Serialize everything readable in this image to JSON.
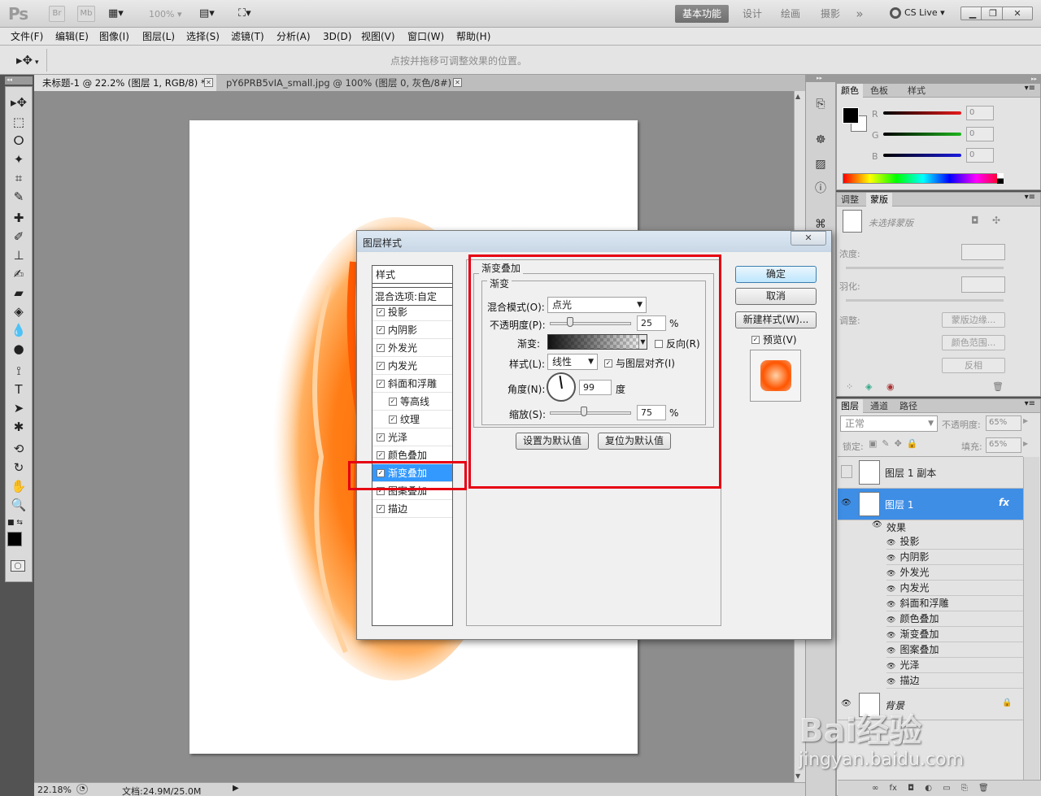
{
  "appbar": {
    "logo": "Ps",
    "br": "Br",
    "mb": "Mb",
    "zoom": "100%",
    "workspaces": [
      "基本功能",
      "设计",
      "绘画",
      "摄影"
    ],
    "more": "»",
    "cslive": "CS Live"
  },
  "menu": [
    "文件(F)",
    "编辑(E)",
    "图像(I)",
    "图层(L)",
    "选择(S)",
    "滤镜(T)",
    "分析(A)",
    "3D(D)",
    "视图(V)",
    "窗口(W)",
    "帮助(H)"
  ],
  "options": {
    "hint": "点按并拖移可调整效果的位置。"
  },
  "tabs": [
    {
      "label": "未标题-1 @ 22.2% (图层 1, RGB/8) *"
    },
    {
      "label": "pY6PRB5vIA_small.jpg @ 100% (图层 0, 灰色/8#) *"
    }
  ],
  "status": {
    "zoom": "22.18%",
    "doc": "文档:24.9M/25.0M"
  },
  "color_panel": {
    "tabs": [
      "颜色",
      "色板",
      "样式"
    ],
    "channels": [
      {
        "name": "R",
        "value": "0",
        "color": "#e8191a"
      },
      {
        "name": "G",
        "value": "0",
        "color": "#1db51d"
      },
      {
        "name": "B",
        "value": "0",
        "color": "#1a1ae0"
      }
    ]
  },
  "adjust_panel": {
    "tabs": [
      "调整",
      "蒙版"
    ],
    "mask_label": "未选择蒙版",
    "density": "浓度:",
    "feather": "羽化:",
    "refine": "调整:",
    "btn_edge": "蒙版边缘...",
    "btn_range": "颜色范围...",
    "btn_invert": "反相"
  },
  "layers_panel": {
    "tabs": [
      "图层",
      "通道",
      "路径"
    ],
    "blend": "正常",
    "opacity_label": "不透明度:",
    "opacity": "65%",
    "lock_label": "锁定:",
    "fill_label": "填充:",
    "fill": "65%",
    "layers": [
      {
        "name": "图层 1 副本",
        "selected": false
      },
      {
        "name": "图层 1",
        "selected": true,
        "fx": "fx"
      }
    ],
    "effects_label": "效果",
    "effects": [
      "投影",
      "内阴影",
      "外发光",
      "内发光",
      "斜面和浮雕",
      "颜色叠加",
      "渐变叠加",
      "图案叠加",
      "光泽",
      "描边"
    ],
    "background": "背景"
  },
  "dialog": {
    "title": "图层样式",
    "list_header": "样式",
    "blend_options": "混合选项:自定",
    "styles": [
      {
        "label": "投影",
        "checked": true,
        "indent": false
      },
      {
        "label": "内阴影",
        "checked": true,
        "indent": false
      },
      {
        "label": "外发光",
        "checked": true,
        "indent": false
      },
      {
        "label": "内发光",
        "checked": true,
        "indent": false
      },
      {
        "label": "斜面和浮雕",
        "checked": true,
        "indent": false
      },
      {
        "label": "等高线",
        "checked": true,
        "indent": true
      },
      {
        "label": "纹理",
        "checked": true,
        "indent": true
      },
      {
        "label": "光泽",
        "checked": true,
        "indent": false
      },
      {
        "label": "颜色叠加",
        "checked": true,
        "indent": false
      },
      {
        "label": "渐变叠加",
        "checked": true,
        "indent": false,
        "selected": true
      },
      {
        "label": "图案叠加",
        "checked": true,
        "indent": false
      },
      {
        "label": "描边",
        "checked": true,
        "indent": false
      }
    ],
    "section_title": "渐变叠加",
    "group_title": "渐变",
    "blend_mode_label": "混合模式(O):",
    "blend_mode": "点光",
    "opacity_label": "不透明度(P):",
    "opacity": "25",
    "percent": "%",
    "gradient_label": "渐变:",
    "reverse": "反向(R)",
    "style_label": "样式(L):",
    "style": "线性",
    "align": "与图层对齐(I)",
    "angle_label": "角度(N):",
    "angle": "99",
    "degree": "度",
    "scale_label": "缩放(S):",
    "scale": "75",
    "set_default": "设置为默认值",
    "reset_default": "复位为默认值",
    "ok": "确定",
    "cancel": "取消",
    "new_style": "新建样式(W)...",
    "preview": "预览(V)",
    "close": "✕"
  },
  "watermark": {
    "main": "Bai经验",
    "url": "jingyan.baidu.com"
  }
}
